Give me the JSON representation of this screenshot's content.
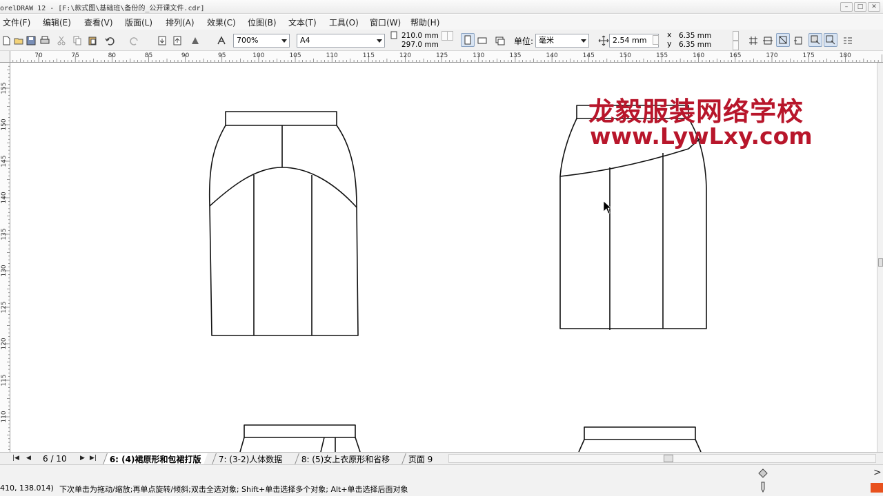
{
  "window": {
    "title": "orelDRAW 12 - [F:\\款式图\\基础班\\备份的_公开课文件.cdr]",
    "controls": [
      "–",
      "□",
      "✕"
    ]
  },
  "menu": [
    "文件(F)",
    "编辑(E)",
    "查看(V)",
    "版面(L)",
    "排列(A)",
    "效果(C)",
    "位图(B)",
    "文本(T)",
    "工具(O)",
    "窗口(W)",
    "帮助(H)"
  ],
  "propbar": {
    "zoom": "700%",
    "paper": "A4",
    "width": "210.0 mm",
    "height": "297.0 mm",
    "unit_label": "单位:",
    "unit": "毫米",
    "nudge": "2.54 mm",
    "dup_x": "6.35 mm",
    "dup_y": "6.35 mm",
    "x_label": "x",
    "y_label": "y"
  },
  "ruler": {
    "h_labels": [
      "70",
      "75",
      "80",
      "85",
      "90",
      "95",
      "100",
      "105",
      "110",
      "115",
      "120",
      "125",
      "130",
      "135",
      "140",
      "145",
      "150",
      "155",
      "160",
      "165",
      "170",
      "175",
      "180"
    ],
    "v_labels": [
      "155",
      "150",
      "145",
      "140",
      "135",
      "130",
      "125",
      "120",
      "115",
      "110"
    ]
  },
  "watermark": {
    "line1": "龙毅服装网络学校",
    "line2": "www.LywLxy.com",
    "color": "#b8162b"
  },
  "pages": {
    "counter": "6 / 10",
    "tabs": [
      "6: (4)裙原形和包裙打版",
      "7: (3-2)人体数据",
      "8: (5)女上衣原形和省移",
      "页面 9"
    ],
    "active_index": 0
  },
  "status": {
    "coords": "410, 138.014)",
    "hint": "下次单击为拖动/缩放;再单点旋转/倾斜;双击全选对象; Shift+单击选择多个对象; Alt+单击选择后面对象",
    "color_swatch": "#e8511d"
  }
}
